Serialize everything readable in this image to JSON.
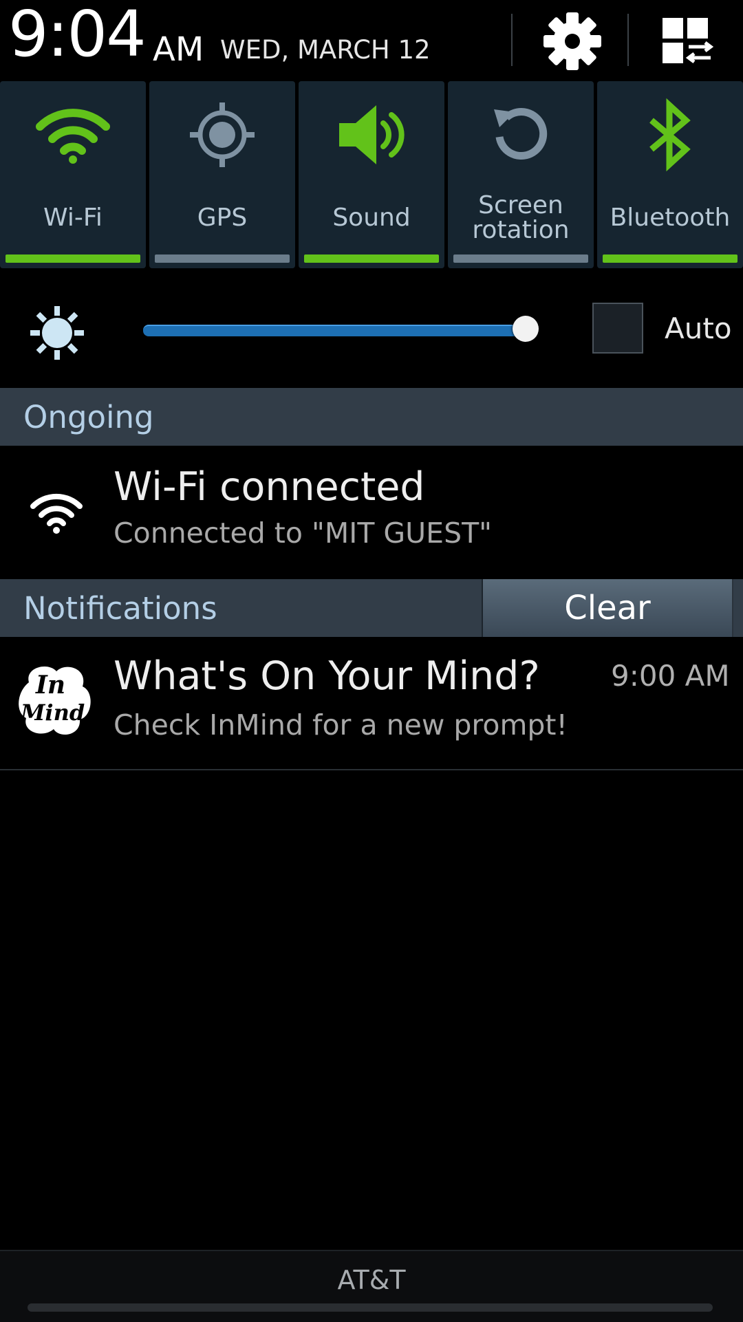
{
  "header": {
    "time": "9:04",
    "ampm": "AM",
    "date": "WED, MARCH 12",
    "settings_icon": "gear-icon",
    "edit_icon": "quick-panel-edit-icon"
  },
  "quick_toggles": [
    {
      "label": "Wi-Fi",
      "icon": "wifi-icon",
      "state": "on"
    },
    {
      "label": "GPS",
      "icon": "gps-icon",
      "state": "off"
    },
    {
      "label": "Sound",
      "icon": "sound-icon",
      "state": "on"
    },
    {
      "label_line1": "Screen",
      "label_line2": "rotation",
      "icon": "rotation-icon",
      "state": "off"
    },
    {
      "label": "Bluetooth",
      "icon": "bluetooth-icon",
      "state": "on"
    }
  ],
  "brightness": {
    "icon": "brightness-icon",
    "level": 1.0,
    "auto_label": "Auto",
    "auto_checked": false
  },
  "ongoing": {
    "section_title": "Ongoing",
    "item": {
      "icon": "wifi-icon",
      "title": "Wi-Fi connected",
      "text": "Connected to \"MIT GUEST\""
    }
  },
  "notifications": {
    "section_title": "Notifications",
    "clear_label": "Clear",
    "items": [
      {
        "icon": "inmind-app-icon",
        "icon_text_line1": "In",
        "icon_text_line2": "Mind",
        "title": "What's On Your Mind?",
        "text": "Check InMind for a new prompt!",
        "time": "9:00 AM"
      }
    ]
  },
  "footer": {
    "carrier": "AT&T"
  },
  "colors": {
    "toggle_on": "#62c21a",
    "toggle_off": "#6b7d8b",
    "toggle_bg": "#162530",
    "section_bg": "#323d48",
    "slider": "#1d6fb3"
  }
}
